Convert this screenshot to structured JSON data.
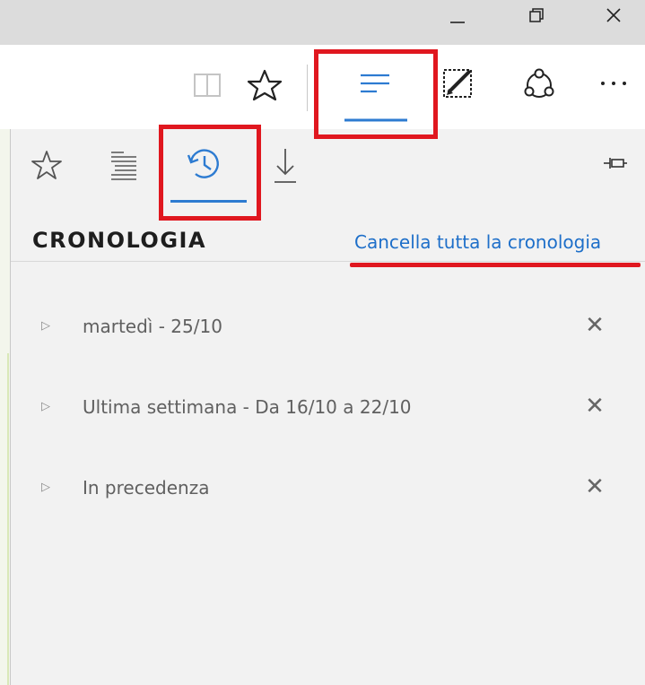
{
  "window": {
    "minimize_icon": "minimize-icon",
    "restore_icon": "restore-icon",
    "close_icon": "close-icon"
  },
  "toolbar": {
    "icons": [
      "reading-view-icon",
      "favorites-star-icon",
      "hub-icon",
      "web-note-icon",
      "share-icon",
      "more-icon"
    ],
    "more_label": "···"
  },
  "hub": {
    "tabs": [
      "favorites-icon",
      "reading-list-icon",
      "history-icon",
      "downloads-icon"
    ],
    "active_tab": "history",
    "pin_icon": "pin-icon",
    "title": "CRONOLOGIA",
    "clear_all": "Cancella tutta la cronologia",
    "groups": [
      {
        "label": "martedì - 25/10"
      },
      {
        "label": "Ultima settimana - Da 16/10 a 22/10"
      },
      {
        "label": "In precedenza"
      }
    ]
  },
  "colors": {
    "accent": "#2d7bd1",
    "link": "#1e6fc9",
    "annotation": "#e0171f",
    "panel_bg": "#f2f2f2",
    "titlebar_bg": "#dcdcdc"
  }
}
